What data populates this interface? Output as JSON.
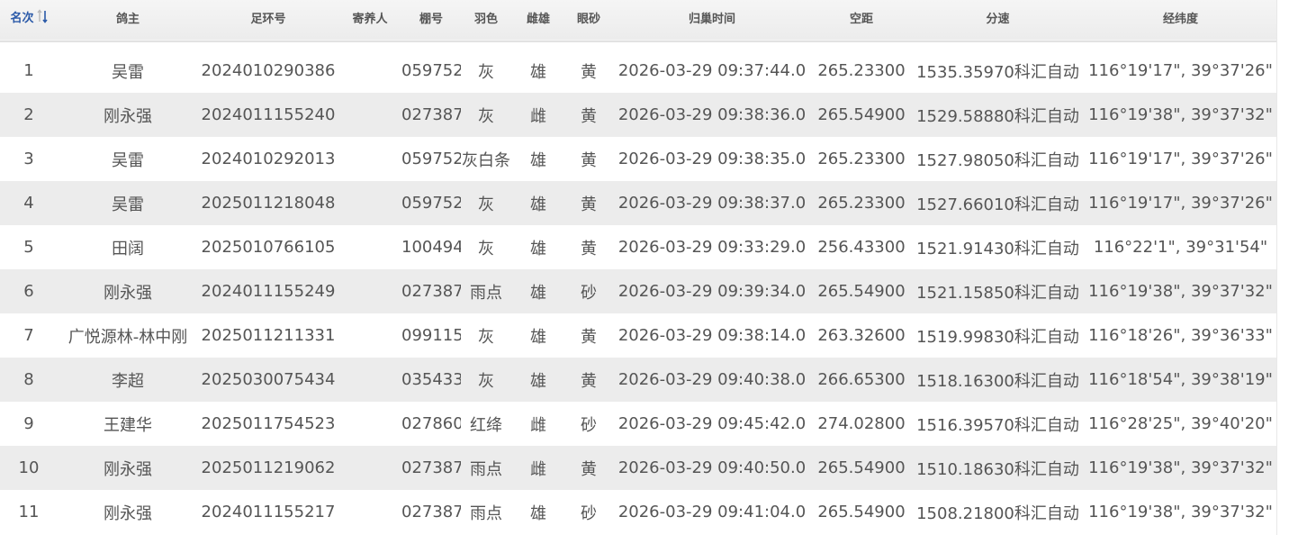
{
  "table": {
    "headers": {
      "rank": "名次",
      "owner": "鸽主",
      "ring": "足环号",
      "boarder": "寄养人",
      "loft": "棚号",
      "color": "羽色",
      "sex": "雌雄",
      "eye": "眼砂",
      "arrival": "归巢时间",
      "distance": "空距",
      "speed": "分速",
      "coords": "经纬度"
    },
    "sort": {
      "column": "rank",
      "icon": "sort-icon"
    },
    "rows": [
      {
        "rank": "1",
        "owner": "吴雷",
        "ring": "2024010290386",
        "boarder": "",
        "loft": "059752",
        "color": "灰",
        "sex": "雄",
        "eye": "黄",
        "arrival": "2026-03-29 09:37:44.0",
        "distance": "265.23300",
        "speed": "1535.35970科汇自动",
        "coords": "116°19'17\", 39°37'26\""
      },
      {
        "rank": "2",
        "owner": "刚永强",
        "ring": "2024011155240",
        "boarder": "",
        "loft": "027387",
        "color": "灰",
        "sex": "雌",
        "eye": "黄",
        "arrival": "2026-03-29 09:38:36.0",
        "distance": "265.54900",
        "speed": "1529.58880科汇自动",
        "coords": "116°19'38\", 39°37'32\""
      },
      {
        "rank": "3",
        "owner": "吴雷",
        "ring": "2024010292013",
        "boarder": "",
        "loft": "059752",
        "color": "灰白条",
        "sex": "雄",
        "eye": "黄",
        "arrival": "2026-03-29 09:38:35.0",
        "distance": "265.23300",
        "speed": "1527.98050科汇自动",
        "coords": "116°19'17\", 39°37'26\""
      },
      {
        "rank": "4",
        "owner": "吴雷",
        "ring": "2025011218048",
        "boarder": "",
        "loft": "059752",
        "color": "灰",
        "sex": "雄",
        "eye": "黄",
        "arrival": "2026-03-29 09:38:37.0",
        "distance": "265.23300",
        "speed": "1527.66010科汇自动",
        "coords": "116°19'17\", 39°37'26\""
      },
      {
        "rank": "5",
        "owner": "田阔",
        "ring": "2025010766105",
        "boarder": "",
        "loft": "100494",
        "color": "灰",
        "sex": "雄",
        "eye": "黄",
        "arrival": "2026-03-29 09:33:29.0",
        "distance": "256.43300",
        "speed": "1521.91430科汇自动",
        "coords": "116°22'1\", 39°31'54\""
      },
      {
        "rank": "6",
        "owner": "刚永强",
        "ring": "2024011155249",
        "boarder": "",
        "loft": "027387",
        "color": "雨点",
        "sex": "雄",
        "eye": "砂",
        "arrival": "2026-03-29 09:39:34.0",
        "distance": "265.54900",
        "speed": "1521.15850科汇自动",
        "coords": "116°19'38\", 39°37'32\""
      },
      {
        "rank": "7",
        "owner": "广悦源林-林中刚",
        "ring": "2025011211331",
        "boarder": "",
        "loft": "099115",
        "color": "灰",
        "sex": "雄",
        "eye": "黄",
        "arrival": "2026-03-29 09:38:14.0",
        "distance": "263.32600",
        "speed": "1519.99830科汇自动",
        "coords": "116°18'26\", 39°36'33\""
      },
      {
        "rank": "8",
        "owner": "李超",
        "ring": "2025030075434",
        "boarder": "",
        "loft": "035433",
        "color": "灰",
        "sex": "雄",
        "eye": "黄",
        "arrival": "2026-03-29 09:40:38.0",
        "distance": "266.65300",
        "speed": "1518.16300科汇自动",
        "coords": "116°18'54\", 39°38'19\""
      },
      {
        "rank": "9",
        "owner": "王建华",
        "ring": "2025011754523",
        "boarder": "",
        "loft": "027860",
        "color": "红绛",
        "sex": "雌",
        "eye": "砂",
        "arrival": "2026-03-29 09:45:42.0",
        "distance": "274.02800",
        "speed": "1516.39570科汇自动",
        "coords": "116°28'25\", 39°40'20\""
      },
      {
        "rank": "10",
        "owner": "刚永强",
        "ring": "2025011219062",
        "boarder": "",
        "loft": "027387",
        "color": "雨点",
        "sex": "雌",
        "eye": "黄",
        "arrival": "2026-03-29 09:40:50.0",
        "distance": "265.54900",
        "speed": "1510.18630科汇自动",
        "coords": "116°19'38\", 39°37'32\""
      },
      {
        "rank": "11",
        "owner": "刚永强",
        "ring": "2024011155217",
        "boarder": "",
        "loft": "027387",
        "color": "雨点",
        "sex": "雄",
        "eye": "砂",
        "arrival": "2026-03-29 09:41:04.0",
        "distance": "265.54900",
        "speed": "1508.21800科汇自动",
        "coords": "116°19'38\", 39°37'32\""
      }
    ]
  },
  "colors": {
    "header_bg": "#f0f0f0",
    "stripe_bg": "#ececec",
    "rank_header": "#2b5aa8",
    "text": "#555555"
  }
}
